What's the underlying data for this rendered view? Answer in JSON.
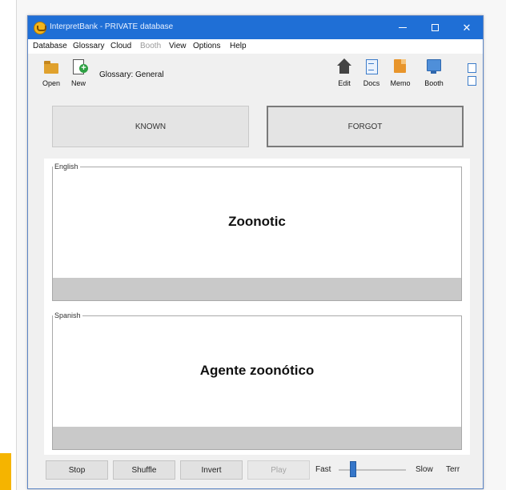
{
  "window": {
    "title": "InterpretBank - PRIVATE database",
    "controls": {
      "minimize": "—",
      "maximize": "□",
      "close": "✕"
    }
  },
  "menu": {
    "items": [
      {
        "label": "Database",
        "enabled": true
      },
      {
        "label": "Glossary",
        "enabled": true
      },
      {
        "label": "Cloud",
        "enabled": true
      },
      {
        "label": "Booth",
        "enabled": false
      },
      {
        "label": "View",
        "enabled": true
      },
      {
        "label": "Options",
        "enabled": true
      },
      {
        "label": "Help",
        "enabled": true
      }
    ]
  },
  "toolbar": {
    "open_label": "Open",
    "new_label": "New",
    "glossary": "Glossary: General",
    "edit_label": "Edit",
    "docs_label": "Docs",
    "memo_label": "Memo",
    "booth_label": "Booth"
  },
  "buttons": {
    "known": "KNOWN",
    "forgot": "FORGOT"
  },
  "panels": {
    "english": {
      "language": "English",
      "term": "Zoonotic"
    },
    "spanish": {
      "language": "Spanish",
      "term": "Agente zoonótico"
    }
  },
  "controls": {
    "stop": "Stop",
    "shuffle": "Shuffle",
    "invert": "Invert",
    "play": "Play",
    "play_enabled": false,
    "fast": "Fast",
    "slow": "Slow",
    "term": "Terr",
    "speed_level": 0.2
  },
  "colors": {
    "titlebar": "#1f6fd6",
    "accent_strip": "#f5b400",
    "slider_thumb": "#3576c9"
  }
}
